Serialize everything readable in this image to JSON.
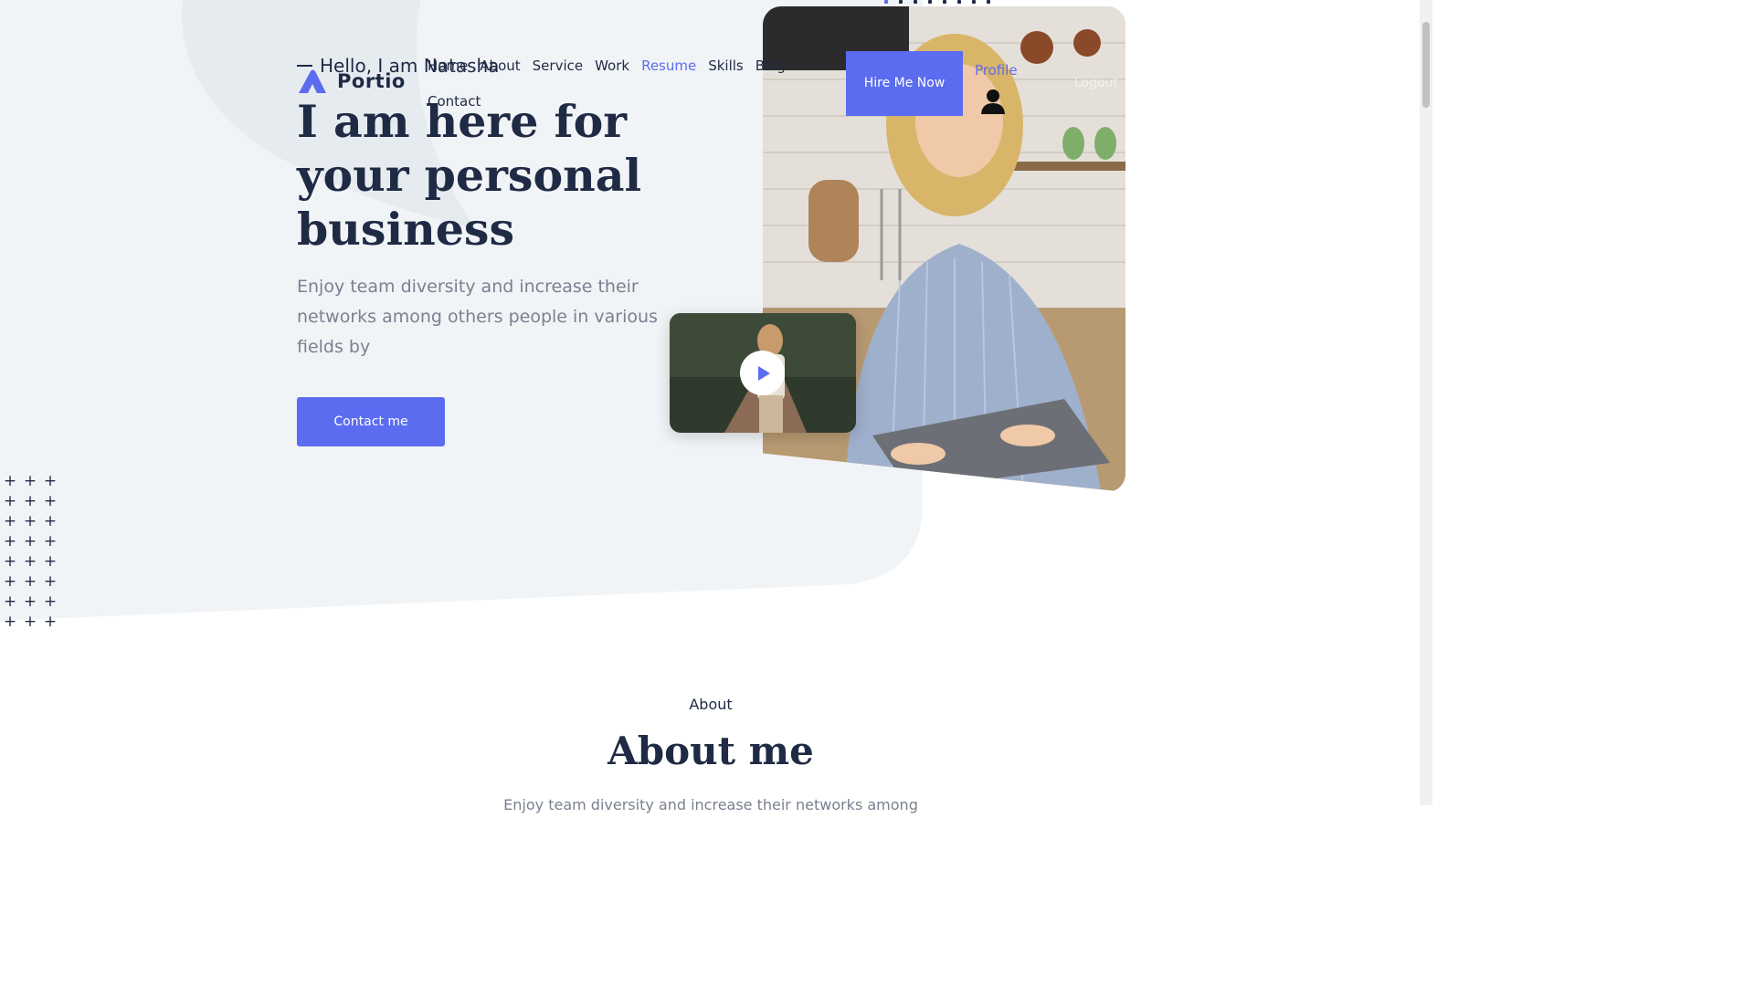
{
  "brand": {
    "name": "Portio",
    "accent": "#5b6cf0",
    "text": "#1f2a44"
  },
  "nav": {
    "items": [
      {
        "label": "Home"
      },
      {
        "label": "About"
      },
      {
        "label": "Service"
      },
      {
        "label": "Work"
      },
      {
        "label": "Resume",
        "active": true
      },
      {
        "label": "Skills"
      },
      {
        "label": "Blog"
      },
      {
        "label": "Contact"
      }
    ]
  },
  "header": {
    "hire_label": "Hire Me Now",
    "profile_label": "Profile",
    "logout_label": "Logout",
    "user_icon": "user-icon"
  },
  "hero": {
    "greeting": "Hello, I am Natasha",
    "title": "I am here for your personal business",
    "description": "Enjoy team diversity and increase their networks among others people in various fields by",
    "cta_label": "Contact me",
    "play_icon": "play-icon"
  },
  "about": {
    "eyebrow": "About",
    "title": "About me",
    "description": "Enjoy team diversity and increase their networks among"
  }
}
